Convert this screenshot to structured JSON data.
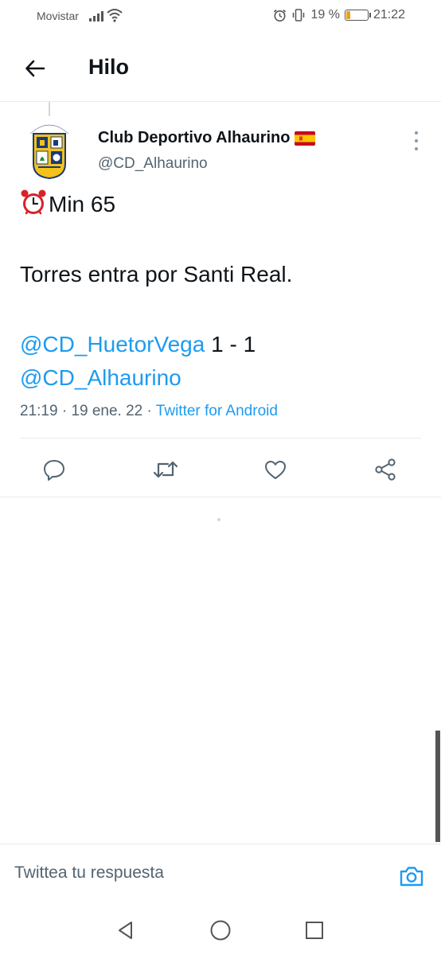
{
  "status_bar": {
    "carrier": "Movistar",
    "battery": "19 %",
    "battery_level": 0.19,
    "time": "21:22",
    "icons": [
      "signal-icon",
      "wifi-icon",
      "alarm-icon",
      "vibrate-icon",
      "battery-icon"
    ]
  },
  "header": {
    "title": "Hilo",
    "back_icon": "arrow-left-icon"
  },
  "tweet": {
    "author_name": "Club Deportivo Alhaurino",
    "author_flag": "spain-flag-icon",
    "author_handle": "@CD_Alhaurino",
    "avatar_text": "C.D. ALHAURINO",
    "lines": {
      "line1_emoji": "alarm-clock-emoji",
      "line1_text": "Min 65",
      "line2_text": "Torres entra por Santi Real.",
      "mention1": "@CD_HuetorVega",
      "score": " 1 - 1",
      "mention2": "@CD_Alhaurino"
    },
    "time": "21:19",
    "separator": " · ",
    "date": "19 ene. 22",
    "source": "Twitter for Android",
    "more_icon": "more-vertical-icon"
  },
  "actions": {
    "reply_icon": "reply-icon",
    "retweet_icon": "retweet-icon",
    "like_icon": "heart-icon",
    "share_icon": "share-icon"
  },
  "reply_bar": {
    "placeholder": "Twittea tu respuesta",
    "camera_icon": "camera-icon"
  },
  "nav_bar": {
    "back_icon": "nav-back-icon",
    "home_icon": "nav-home-icon",
    "recents_icon": "nav-recents-icon"
  },
  "colors": {
    "accent": "#1d9bf0",
    "text": "#0f1419",
    "secondary_text": "#536471",
    "divider": "#e6ecf0"
  }
}
